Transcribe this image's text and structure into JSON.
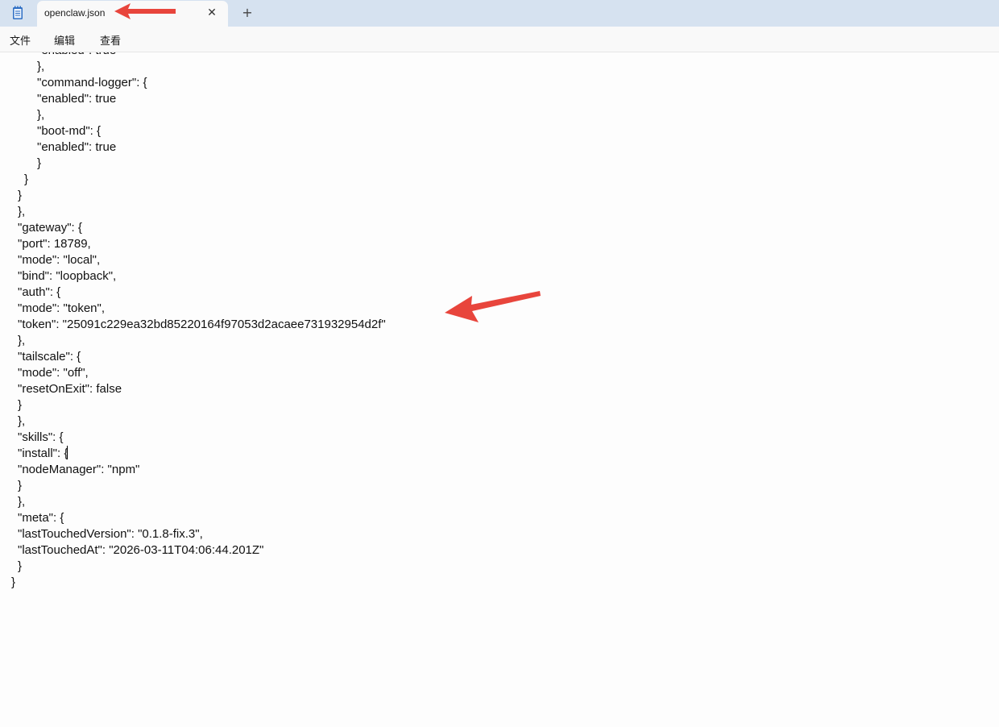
{
  "window": {
    "app_icon": "notepad-icon",
    "tab": {
      "title": "openclaw.json",
      "close_icon": "close-icon",
      "close_glyph": "✕"
    },
    "new_tab_glyph": "+"
  },
  "menu": {
    "items": [
      "文件",
      "编辑",
      "查看"
    ]
  },
  "editor": {
    "lines": [
      "        \"enabled\": true",
      "      },",
      "      \"command-logger\": {",
      "        \"enabled\": true",
      "      },",
      "      \"boot-md\": {",
      "        \"enabled\": true",
      "      }",
      "    }",
      "  }",
      "},",
      "\"gateway\": {",
      "  \"port\": 18789,",
      "  \"mode\": \"local\",",
      "  \"bind\": \"loopback\",",
      "  \"auth\": {",
      "    \"mode\": \"token\",",
      "    \"token\": \"25091c229ea32bd85220164f97053d2acaee731932954d2f\"",
      "  },",
      "  \"tailscale\": {",
      "    \"mode\": \"off\",",
      "    \"resetOnExit\": false",
      "  }",
      "},",
      "\"skills\": {",
      "  \"install\": {",
      "    \"nodeManager\": \"npm\"",
      "  }",
      "},",
      "\"meta\": {",
      "  \"lastTouchedVersion\": \"0.1.8-fix.3\",",
      "  \"lastTouchedAt\": \"2026-03-11T04:06:44.201Z\"",
      "}",
      "}"
    ]
  },
  "annotations": {
    "color": "#e8453c",
    "arrows": [
      "arrow-to-tab-title",
      "arrow-to-token-line"
    ]
  }
}
